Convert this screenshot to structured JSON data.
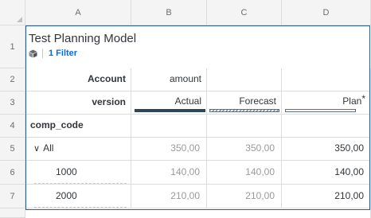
{
  "columns": [
    "A",
    "B",
    "C",
    "D"
  ],
  "rows": [
    "1",
    "2",
    "3",
    "4",
    "5",
    "6",
    "7"
  ],
  "title": "Test Planning Model",
  "filter_label": "1 Filter",
  "account_label": "Account",
  "account_value": "amount",
  "version_label": "version",
  "versions": {
    "actual": "Actual",
    "forecast": "Forecast",
    "plan": "Plan",
    "plan_marker": "*"
  },
  "comp_code_label": "comp_code",
  "tree": {
    "toggle": "∨",
    "all": {
      "label": "All",
      "actual": "350,00",
      "forecast": "350,00",
      "plan": "350,00"
    },
    "children": [
      {
        "label": "1000",
        "actual": "140,00",
        "forecast": "140,00",
        "plan": "140,00"
      },
      {
        "label": "2000",
        "actual": "210,00",
        "forecast": "210,00",
        "plan": "210,00"
      }
    ]
  },
  "colors": {
    "accent": "#0a6ed1",
    "selection_border": "#2c5f8a",
    "actual_bar": "#2f4657"
  }
}
